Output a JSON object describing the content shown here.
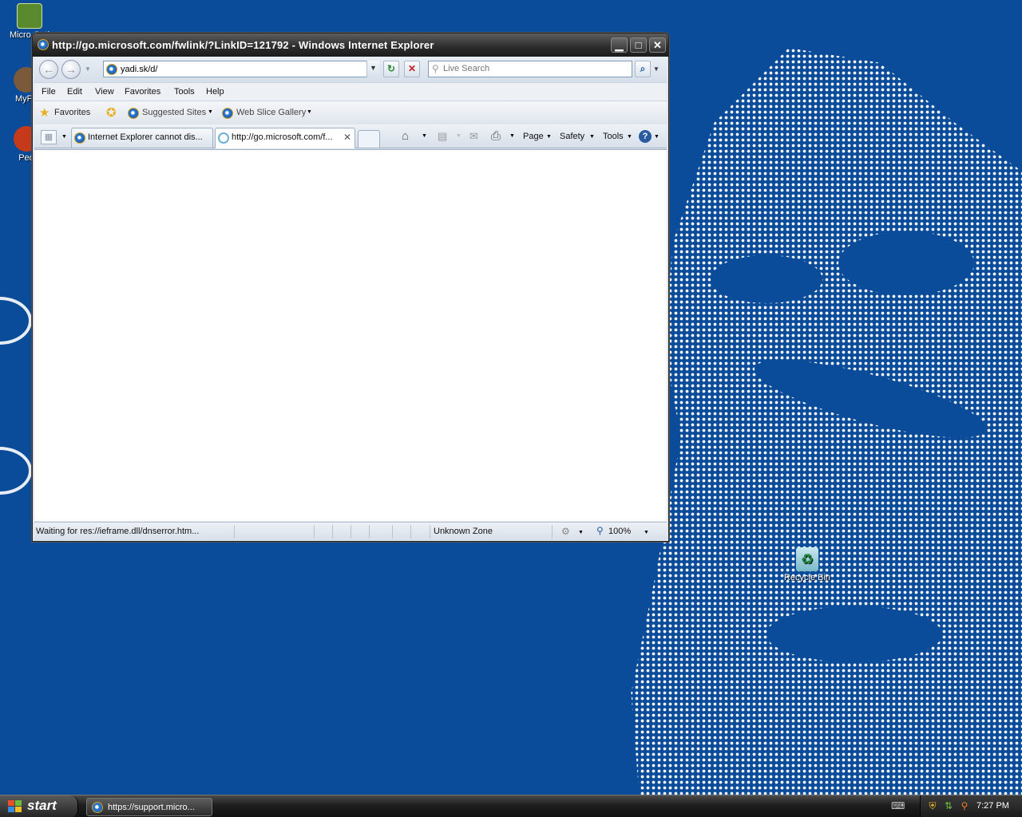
{
  "desktop": {
    "icons": [
      {
        "label": "Micro Outl",
        "color": "#5a8a2e"
      },
      {
        "label": "MyPa",
        "color": "#7a5a3a"
      },
      {
        "label": "Peo",
        "color": "#c43a1a"
      },
      {
        "label": "Recycle Bin",
        "color": "#3aa05a"
      }
    ]
  },
  "window": {
    "title": "http://go.microsoft.com/fwlink/?LinkID=121792 - Windows Internet Explorer",
    "minimize": "▁",
    "maximize": "□",
    "close": "✕"
  },
  "nav": {
    "back": "←",
    "forward": "→",
    "address": "yadi.sk/d/",
    "refresh": "↻",
    "stop": "✕",
    "search_placeholder": "Live Search",
    "search_button": "⌕"
  },
  "menu": [
    "File",
    "Edit",
    "View",
    "Favorites",
    "Tools",
    "Help"
  ],
  "favorites_bar": {
    "favorites": "Favorites",
    "suggested_sites": "Suggested Sites",
    "web_slice_gallery": "Web Slice Gallery"
  },
  "tabs": [
    {
      "label": "Internet Explorer cannot dis...",
      "active": false
    },
    {
      "label": "http://go.microsoft.com/f...",
      "active": true
    }
  ],
  "command_bar": {
    "page": "Page",
    "safety": "Safety",
    "tools": "Tools"
  },
  "status": {
    "text": "Waiting for res://ieframe.dll/dnserror.htm...",
    "zone": "Unknown Zone",
    "zoom": "100%"
  },
  "taskbar": {
    "start": "start",
    "task_label": "https://support.micro...",
    "clock": "7:27 PM"
  },
  "colors": {
    "desktop": "#0a4c99",
    "titlebar": "#2b2b2b",
    "chrome": "#dfe6ef"
  }
}
